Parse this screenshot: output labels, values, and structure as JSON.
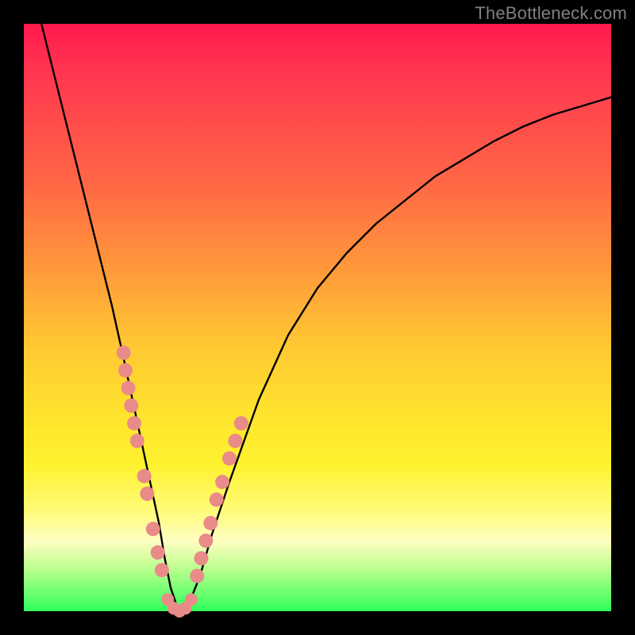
{
  "watermark": "TheBottleneck.com",
  "chart_data": {
    "type": "line",
    "title": "",
    "xlabel": "",
    "ylabel": "",
    "xlim": [
      0,
      100
    ],
    "ylim": [
      0,
      100
    ],
    "grid": false,
    "series": [
      {
        "name": "curve",
        "x": [
          3,
          5,
          7,
          9,
          11,
          13,
          15,
          17,
          18.5,
          20,
          21.5,
          23,
          24,
          25,
          26,
          27,
          28,
          30,
          32,
          35,
          40,
          45,
          50,
          55,
          60,
          65,
          70,
          75,
          80,
          85,
          90,
          95,
          100
        ],
        "y": [
          100,
          92,
          84,
          76,
          68,
          60,
          52,
          43,
          36,
          29,
          22,
          15,
          9,
          4,
          1,
          0,
          1,
          6,
          13,
          22,
          36,
          47,
          55,
          61,
          66,
          70,
          74,
          77,
          80,
          82.5,
          84.5,
          86,
          87.5
        ]
      }
    ],
    "markers": {
      "left_cluster": [
        {
          "x": 17.0,
          "y": 44
        },
        {
          "x": 17.3,
          "y": 41
        },
        {
          "x": 17.8,
          "y": 38
        },
        {
          "x": 18.3,
          "y": 35
        },
        {
          "x": 18.8,
          "y": 32
        },
        {
          "x": 19.3,
          "y": 29
        },
        {
          "x": 20.5,
          "y": 23
        },
        {
          "x": 21.0,
          "y": 20
        },
        {
          "x": 22.0,
          "y": 14
        },
        {
          "x": 22.8,
          "y": 10
        },
        {
          "x": 23.5,
          "y": 7
        }
      ],
      "bottom_cluster": [
        {
          "x": 24.5,
          "y": 2
        },
        {
          "x": 25.5,
          "y": 0.5
        },
        {
          "x": 26.5,
          "y": 0
        },
        {
          "x": 27.5,
          "y": 0.5
        },
        {
          "x": 28.5,
          "y": 2
        }
      ],
      "right_cluster": [
        {
          "x": 29.5,
          "y": 6
        },
        {
          "x": 30.2,
          "y": 9
        },
        {
          "x": 31.0,
          "y": 12
        },
        {
          "x": 31.8,
          "y": 15
        },
        {
          "x": 32.8,
          "y": 19
        },
        {
          "x": 33.8,
          "y": 22
        },
        {
          "x": 35.0,
          "y": 26
        },
        {
          "x": 36.0,
          "y": 29
        },
        {
          "x": 37.0,
          "y": 32
        }
      ]
    },
    "gradient_stops": [
      {
        "pos": 0,
        "color": "#ff1a4d"
      },
      {
        "pos": 50,
        "color": "#ffc832"
      },
      {
        "pos": 85,
        "color": "#fffb7a"
      },
      {
        "pos": 100,
        "color": "#2fff5a"
      }
    ]
  }
}
